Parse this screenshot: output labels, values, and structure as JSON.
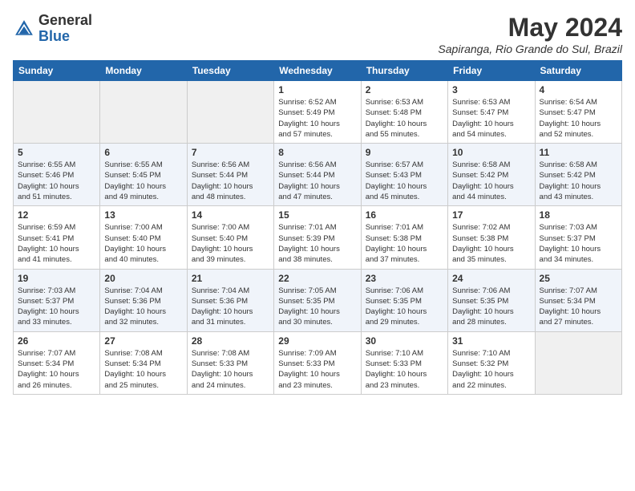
{
  "header": {
    "logo_general": "General",
    "logo_blue": "Blue",
    "month_year": "May 2024",
    "location": "Sapiranga, Rio Grande do Sul, Brazil"
  },
  "weekdays": [
    "Sunday",
    "Monday",
    "Tuesday",
    "Wednesday",
    "Thursday",
    "Friday",
    "Saturday"
  ],
  "weeks": [
    [
      {
        "day": "",
        "info": ""
      },
      {
        "day": "",
        "info": ""
      },
      {
        "day": "",
        "info": ""
      },
      {
        "day": "1",
        "info": "Sunrise: 6:52 AM\nSunset: 5:49 PM\nDaylight: 10 hours\nand 57 minutes."
      },
      {
        "day": "2",
        "info": "Sunrise: 6:53 AM\nSunset: 5:48 PM\nDaylight: 10 hours\nand 55 minutes."
      },
      {
        "day": "3",
        "info": "Sunrise: 6:53 AM\nSunset: 5:47 PM\nDaylight: 10 hours\nand 54 minutes."
      },
      {
        "day": "4",
        "info": "Sunrise: 6:54 AM\nSunset: 5:47 PM\nDaylight: 10 hours\nand 52 minutes."
      }
    ],
    [
      {
        "day": "5",
        "info": "Sunrise: 6:55 AM\nSunset: 5:46 PM\nDaylight: 10 hours\nand 51 minutes."
      },
      {
        "day": "6",
        "info": "Sunrise: 6:55 AM\nSunset: 5:45 PM\nDaylight: 10 hours\nand 49 minutes."
      },
      {
        "day": "7",
        "info": "Sunrise: 6:56 AM\nSunset: 5:44 PM\nDaylight: 10 hours\nand 48 minutes."
      },
      {
        "day": "8",
        "info": "Sunrise: 6:56 AM\nSunset: 5:44 PM\nDaylight: 10 hours\nand 47 minutes."
      },
      {
        "day": "9",
        "info": "Sunrise: 6:57 AM\nSunset: 5:43 PM\nDaylight: 10 hours\nand 45 minutes."
      },
      {
        "day": "10",
        "info": "Sunrise: 6:58 AM\nSunset: 5:42 PM\nDaylight: 10 hours\nand 44 minutes."
      },
      {
        "day": "11",
        "info": "Sunrise: 6:58 AM\nSunset: 5:42 PM\nDaylight: 10 hours\nand 43 minutes."
      }
    ],
    [
      {
        "day": "12",
        "info": "Sunrise: 6:59 AM\nSunset: 5:41 PM\nDaylight: 10 hours\nand 41 minutes."
      },
      {
        "day": "13",
        "info": "Sunrise: 7:00 AM\nSunset: 5:40 PM\nDaylight: 10 hours\nand 40 minutes."
      },
      {
        "day": "14",
        "info": "Sunrise: 7:00 AM\nSunset: 5:40 PM\nDaylight: 10 hours\nand 39 minutes."
      },
      {
        "day": "15",
        "info": "Sunrise: 7:01 AM\nSunset: 5:39 PM\nDaylight: 10 hours\nand 38 minutes."
      },
      {
        "day": "16",
        "info": "Sunrise: 7:01 AM\nSunset: 5:38 PM\nDaylight: 10 hours\nand 37 minutes."
      },
      {
        "day": "17",
        "info": "Sunrise: 7:02 AM\nSunset: 5:38 PM\nDaylight: 10 hours\nand 35 minutes."
      },
      {
        "day": "18",
        "info": "Sunrise: 7:03 AM\nSunset: 5:37 PM\nDaylight: 10 hours\nand 34 minutes."
      }
    ],
    [
      {
        "day": "19",
        "info": "Sunrise: 7:03 AM\nSunset: 5:37 PM\nDaylight: 10 hours\nand 33 minutes."
      },
      {
        "day": "20",
        "info": "Sunrise: 7:04 AM\nSunset: 5:36 PM\nDaylight: 10 hours\nand 32 minutes."
      },
      {
        "day": "21",
        "info": "Sunrise: 7:04 AM\nSunset: 5:36 PM\nDaylight: 10 hours\nand 31 minutes."
      },
      {
        "day": "22",
        "info": "Sunrise: 7:05 AM\nSunset: 5:35 PM\nDaylight: 10 hours\nand 30 minutes."
      },
      {
        "day": "23",
        "info": "Sunrise: 7:06 AM\nSunset: 5:35 PM\nDaylight: 10 hours\nand 29 minutes."
      },
      {
        "day": "24",
        "info": "Sunrise: 7:06 AM\nSunset: 5:35 PM\nDaylight: 10 hours\nand 28 minutes."
      },
      {
        "day": "25",
        "info": "Sunrise: 7:07 AM\nSunset: 5:34 PM\nDaylight: 10 hours\nand 27 minutes."
      }
    ],
    [
      {
        "day": "26",
        "info": "Sunrise: 7:07 AM\nSunset: 5:34 PM\nDaylight: 10 hours\nand 26 minutes."
      },
      {
        "day": "27",
        "info": "Sunrise: 7:08 AM\nSunset: 5:34 PM\nDaylight: 10 hours\nand 25 minutes."
      },
      {
        "day": "28",
        "info": "Sunrise: 7:08 AM\nSunset: 5:33 PM\nDaylight: 10 hours\nand 24 minutes."
      },
      {
        "day": "29",
        "info": "Sunrise: 7:09 AM\nSunset: 5:33 PM\nDaylight: 10 hours\nand 23 minutes."
      },
      {
        "day": "30",
        "info": "Sunrise: 7:10 AM\nSunset: 5:33 PM\nDaylight: 10 hours\nand 23 minutes."
      },
      {
        "day": "31",
        "info": "Sunrise: 7:10 AM\nSunset: 5:32 PM\nDaylight: 10 hours\nand 22 minutes."
      },
      {
        "day": "",
        "info": ""
      }
    ]
  ]
}
